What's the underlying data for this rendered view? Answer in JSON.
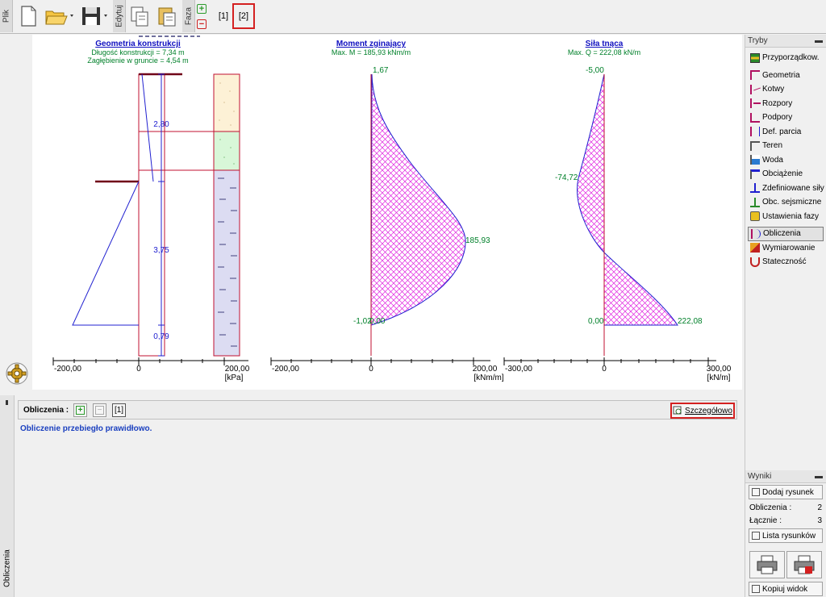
{
  "toolbar": {
    "tab_file": "Plik",
    "tab_edit": "Edytuj",
    "tab_phase": "Faza",
    "phases": [
      "[1]",
      "[2]"
    ],
    "add_phase": "+",
    "remove_phase": "−"
  },
  "geometry": {
    "title": "Geometria konstrukcji",
    "length": "Długość konstrukcji = 7,34 m",
    "depth": "Zagłębienie w gruncie = 4,54 m",
    "dims": [
      "2,80",
      "3,75",
      "0,79"
    ],
    "axis_ticks": [
      "-200,00",
      "0",
      "200,00"
    ],
    "unit": "[kPa]"
  },
  "moment": {
    "title": "Moment zginający",
    "max": "Max. M = 185,93 kNm/m",
    "labels": [
      "1,67",
      "185,93",
      "-1,02",
      "0,00"
    ],
    "axis_ticks": [
      "-200,00",
      "0",
      "200,00"
    ],
    "unit": "[kNm/m]"
  },
  "shear": {
    "title": "Siła tnąca",
    "max": "Max. Q = 222,08 kN/m",
    "labels": [
      "-5,00",
      "-74,72",
      "0,00",
      "222,08"
    ],
    "axis_ticks": [
      "-300,00",
      "0",
      "300,00"
    ],
    "unit": "[kN/m]"
  },
  "modes": {
    "header": "Tryby",
    "items": [
      {
        "label": "Przyporządkow.",
        "icon": "assign-icon"
      },
      {
        "label": "Geometria",
        "icon": "geometry-icon"
      },
      {
        "label": "Kotwy",
        "icon": "anchor-icon"
      },
      {
        "label": "Rozpory",
        "icon": "props-icon"
      },
      {
        "label": "Podpory",
        "icon": "supports-icon"
      },
      {
        "label": "Def. parcia",
        "icon": "pressure-def-icon"
      },
      {
        "label": "Teren",
        "icon": "terrain-icon"
      },
      {
        "label": "Woda",
        "icon": "water-icon"
      },
      {
        "label": "Obciążenie",
        "icon": "surcharge-icon"
      },
      {
        "label": "Zdefiniowane siły",
        "icon": "forces-icon"
      },
      {
        "label": "Obc. sejsmiczne",
        "icon": "earthquake-icon"
      },
      {
        "label": "Ustawienia fazy",
        "icon": "phase-settings-icon"
      },
      {
        "label": "Obliczenia",
        "icon": "analysis-icon"
      },
      {
        "label": "Wymiarowanie",
        "icon": "dimensioning-icon"
      },
      {
        "label": "Stateczność",
        "icon": "stability-icon"
      }
    ]
  },
  "results": {
    "header": "Wyniki",
    "add_picture": "Dodaj rysunek",
    "calc_label": "Obliczenia :",
    "calc_value": "2",
    "total_label": "Łącznie :",
    "total_value": "3",
    "list_pictures": "Lista rysunków",
    "copy_view": "Kopiuj widok"
  },
  "bottom": {
    "tab_label": "Obliczenia",
    "bar_label": "Obliczenia :",
    "analysis_index": "[1]",
    "details": "Szczegółowo",
    "message": "Obliczenie przebiegło prawidłowo."
  },
  "colors": {
    "title_blue": "#1010c0",
    "label_green": "#00802a",
    "hatch_magenta": "#e020e0",
    "outline_blue": "#2020d0",
    "wall_red": "#c01030",
    "soil_1": "#fdf1d6",
    "soil_2": "#d8f7d8",
    "soil_3": "#dcdcf2",
    "highlight_red": "#d42020"
  }
}
